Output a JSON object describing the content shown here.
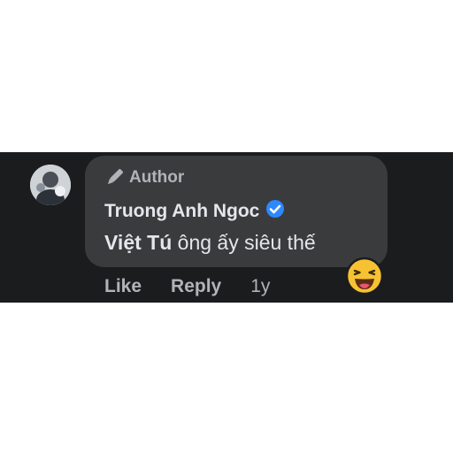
{
  "comment": {
    "author_badge": "Author",
    "author_name": "Truong Anh Ngoc",
    "verified": true,
    "mention": "Việt Tú",
    "text": " ông ấy siêu thế",
    "actions": {
      "like": "Like",
      "reply": "Reply",
      "time": "1y"
    },
    "reaction": "laughing-emoji"
  },
  "colors": {
    "background": "#1b1c1e",
    "bubble": "#3a3b3c",
    "primary_text": "#e4e6eb",
    "secondary_text": "#b0b3b8",
    "verified_blue": "#2d88ff",
    "emoji_yellow": "#f7c232"
  }
}
